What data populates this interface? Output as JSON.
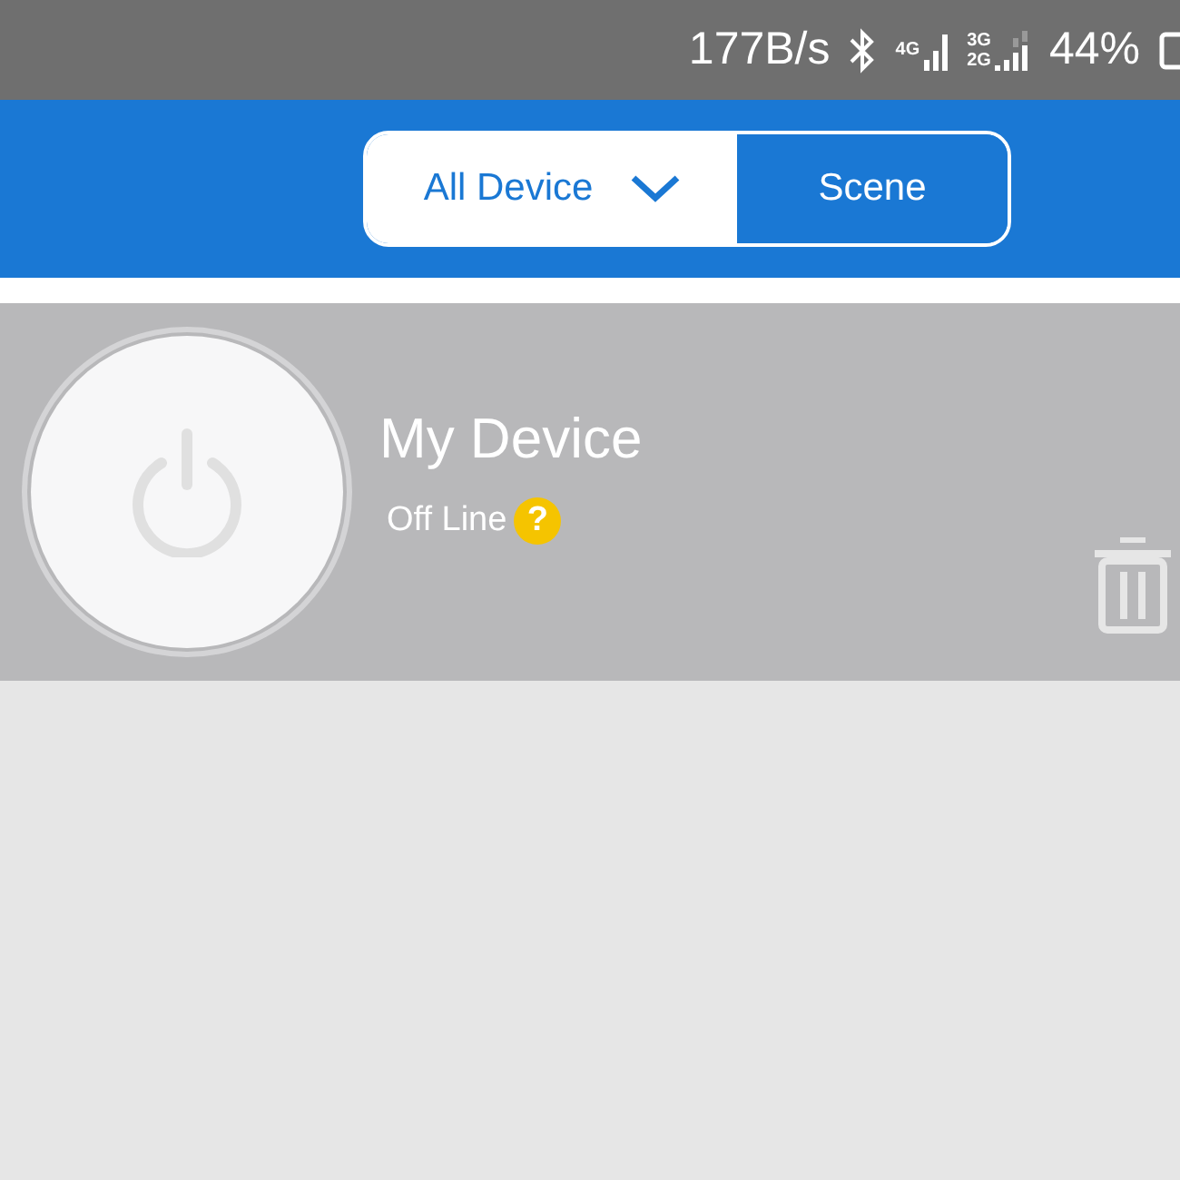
{
  "status_bar": {
    "speed": "177B/s",
    "network_4g": "4G",
    "network_3g": "3G",
    "network_2g": "2G",
    "battery": "44%"
  },
  "tabs": [
    {
      "label": "All Device",
      "selected": true,
      "dropdown": true
    },
    {
      "label": "Scene",
      "selected": false,
      "dropdown": false
    }
  ],
  "devices": [
    {
      "name": "My Device",
      "status": "Off Line",
      "online": false,
      "help": "?"
    }
  ]
}
